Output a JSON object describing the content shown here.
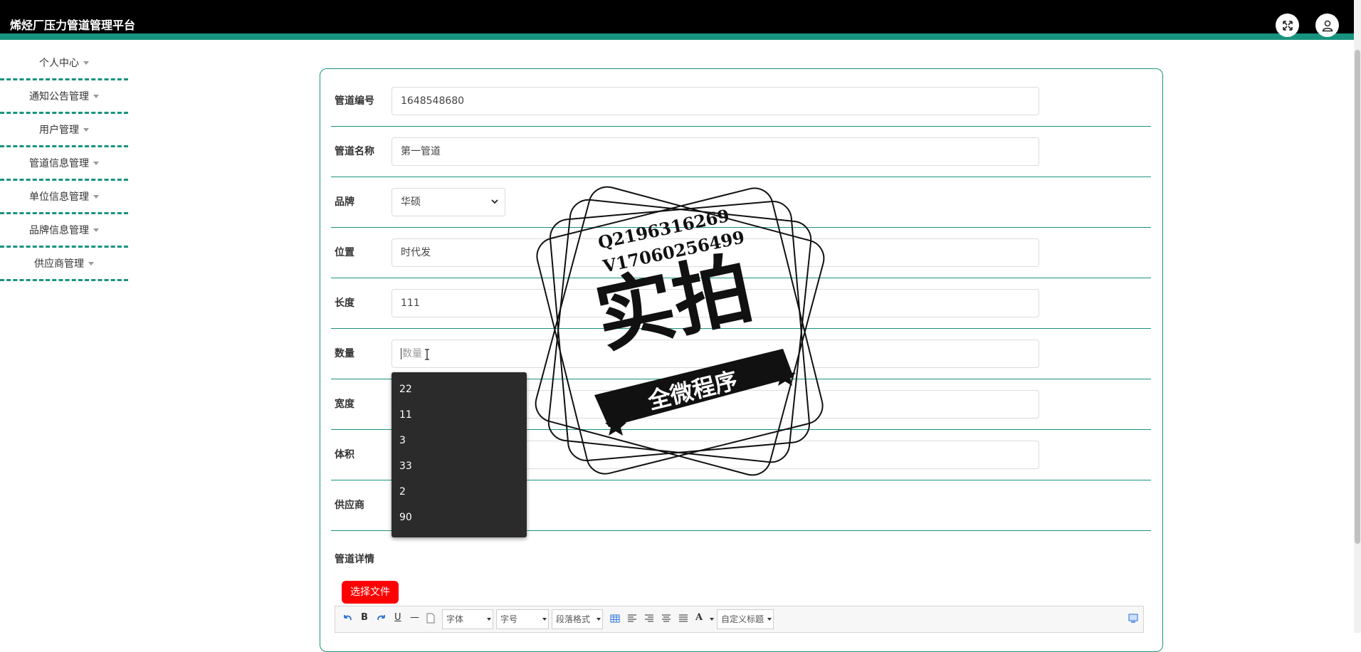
{
  "app": {
    "title": "烯烃厂压力管道管理平台"
  },
  "header": {
    "fullscreen_icon": "expand-icon",
    "user_icon": "user-icon"
  },
  "sidebar": {
    "items": [
      {
        "label": "个人中心"
      },
      {
        "label": "通知公告管理"
      },
      {
        "label": "用户管理"
      },
      {
        "label": "管道信息管理"
      },
      {
        "label": "单位信息管理"
      },
      {
        "label": "品牌信息管理"
      },
      {
        "label": "供应商管理"
      }
    ]
  },
  "form": {
    "pipe_no": {
      "label": "管道编号",
      "value": "1648548680"
    },
    "pipe_name": {
      "label": "管道名称",
      "value": "第一管道"
    },
    "brand": {
      "label": "品牌",
      "value": "华硕"
    },
    "location": {
      "label": "位置",
      "value": "时代发"
    },
    "length": {
      "label": "长度",
      "value": "111"
    },
    "quantity": {
      "label": "数量",
      "placeholder": "数量"
    },
    "width": {
      "label": "宽度"
    },
    "volume": {
      "label": "体积"
    },
    "supplier": {
      "label": "供应商"
    },
    "details": {
      "label": "管道详情"
    }
  },
  "autocomplete": {
    "options": [
      "22",
      "11",
      "3",
      "33",
      "2",
      "90"
    ]
  },
  "upload": {
    "button_label": "选择文件"
  },
  "editor": {
    "font_family": "字体",
    "font_size": "字号",
    "paragraph": "段落格式",
    "custom_title": "自定义标题"
  },
  "watermark": {
    "line1": "Q2196316269",
    "line2": "V17060256499",
    "main": "实拍",
    "ribbon": "全微程序"
  }
}
